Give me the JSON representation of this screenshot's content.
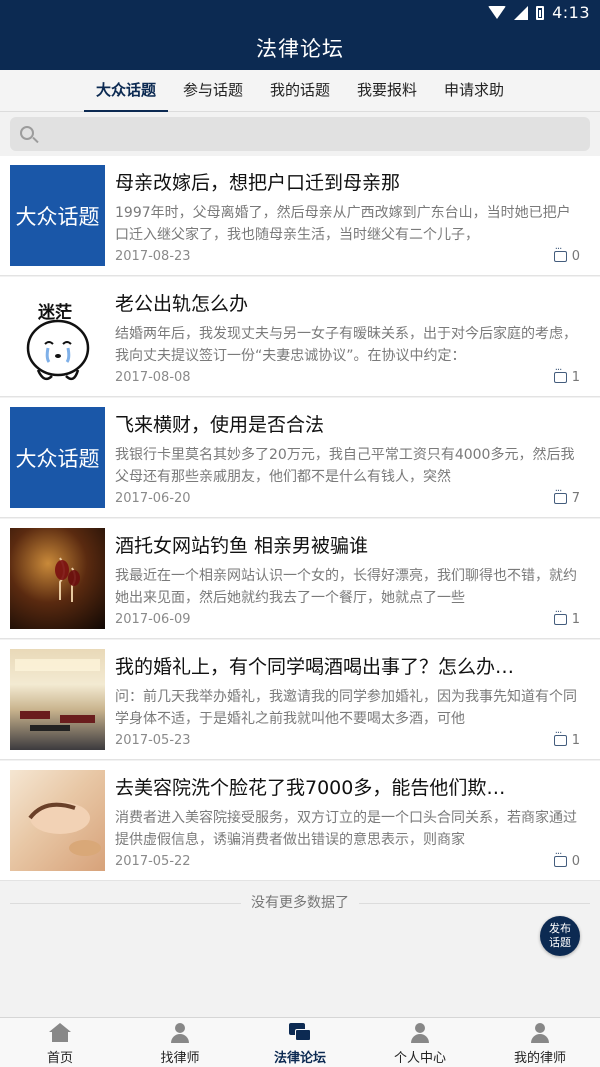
{
  "status_bar": {
    "time": "4:13"
  },
  "header": {
    "title": "法律论坛"
  },
  "tabs": [
    {
      "label": "大众话题",
      "active": true
    },
    {
      "label": "参与话题",
      "active": false
    },
    {
      "label": "我的话题",
      "active": false
    },
    {
      "label": "我要报料",
      "active": false
    },
    {
      "label": "申请求助",
      "active": false
    }
  ],
  "search": {
    "placeholder": ""
  },
  "posts": [
    {
      "thumb_text": "大众话题",
      "title": "母亲改嫁后，想把户口迁到母亲那",
      "excerpt": "1997年时，父母离婚了，然后母亲从广西改嫁到广东台山，当时她已把户口迁入继父家了，我也随母亲生活，当时继父有二个儿子，",
      "date": "2017-08-23",
      "comments": "0"
    },
    {
      "thumb_text": "迷茫",
      "title": "老公出轨怎么办",
      "excerpt": "结婚两年后，我发现丈夫与另一女子有暧昧关系，出于对今后家庭的考虑，我向丈夫提议签订一份“夫妻忠诚协议”。在协议中约定：",
      "date": "2017-08-08",
      "comments": "1"
    },
    {
      "thumb_text": "大众话题",
      "title": "飞来横财，使用是否合法",
      "excerpt": "我银行卡里莫名其妙多了20万元，我自己平常工资只有4000多元，然后我父母还有那些亲戚朋友，他们都不是什么有钱人，突然",
      "date": "2017-06-20",
      "comments": "7"
    },
    {
      "thumb_text": "",
      "title": "酒托女网站钓鱼 相亲男被骗谁",
      "excerpt": "我最近在一个相亲网站认识一个女的，长得好漂亮，我们聊得也不错，就约她出来见面，然后她就约我去了一个餐厅，她就点了一些",
      "date": "2017-06-09",
      "comments": "1"
    },
    {
      "thumb_text": "",
      "title": "我的婚礼上，有个同学喝酒喝出事了？怎么办…",
      "excerpt": "问：前几天我举办婚礼，我邀请我的同学参加婚礼，因为我事先知道有个同学身体不适，于是婚礼之前我就叫他不要喝太多酒，可他",
      "date": "2017-05-23",
      "comments": "1"
    },
    {
      "thumb_text": "",
      "title": "去美容院洗个脸花了我7000多，能告他们欺…",
      "excerpt": "消费者进入美容院接受服务，双方订立的是一个口头合同关系，若商家通过提供虚假信息，诱骗消费者做出错误的意思表示，则商家",
      "date": "2017-05-22",
      "comments": "0"
    }
  ],
  "no_more": "没有更多数据了",
  "fab": {
    "label": "发布话题"
  },
  "bottom_nav": [
    {
      "label": "首页",
      "icon": "home-icon",
      "active": false
    },
    {
      "label": "找律师",
      "icon": "find-lawyer-icon",
      "active": false
    },
    {
      "label": "法律论坛",
      "icon": "forum-icon",
      "active": true
    },
    {
      "label": "个人中心",
      "icon": "profile-icon",
      "active": false
    },
    {
      "label": "我的律师",
      "icon": "my-lawyer-icon",
      "active": false
    }
  ],
  "colors": {
    "primary": "#0c2a52",
    "thumb_blue": "#1a57a8",
    "background": "#f2f2f2"
  }
}
